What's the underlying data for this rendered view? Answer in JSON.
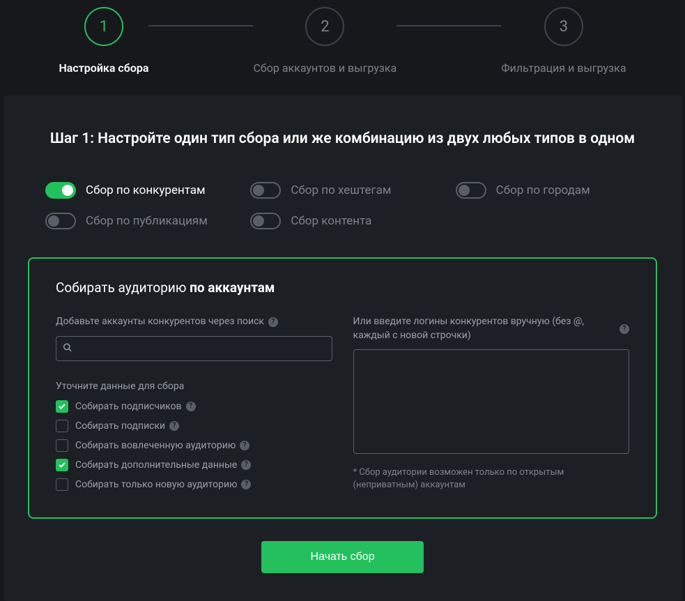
{
  "stepper": {
    "steps": [
      {
        "number": "1",
        "label": "Настройка сбора",
        "active": true
      },
      {
        "number": "2",
        "label": "Сбор аккаунтов и выгрузка",
        "active": false
      },
      {
        "number": "3",
        "label": "Фильтрация и выгрузка",
        "active": false
      }
    ]
  },
  "main": {
    "title": "Шаг 1: Настройте один тип сбора или же комбинацию из двух любых типов в одном"
  },
  "toggles": [
    {
      "label": "Сбор по конкурентам",
      "on": true
    },
    {
      "label": "Сбор по хештегам",
      "on": false
    },
    {
      "label": "Сбор по городам",
      "on": false
    },
    {
      "label": "Сбор по публикациям",
      "on": false
    },
    {
      "label": "Сбор контента",
      "on": false
    }
  ],
  "form": {
    "title_prefix": "Собирать аудиторию ",
    "title_bold": "по аккаунтам",
    "search_label": "Добавьте аккаунты конкурентов через поиск",
    "section_label": "Уточните данные для сбора",
    "checkboxes": [
      {
        "label": "Собирать подписчиков",
        "checked": true
      },
      {
        "label": "Собирать подписки",
        "checked": false
      },
      {
        "label": "Собирать вовлеченную аудиторию",
        "checked": false
      },
      {
        "label": "Собирать дополнительные данные",
        "checked": true
      },
      {
        "label": "Собирать только новую аудиторию",
        "checked": false
      }
    ],
    "textarea_label": "Или введите логины конкурентов вручную (без @, каждый с новой строчки)",
    "hint": "* Сбор аудитории возможен только по открытым (неприватным) аккаунтам"
  },
  "submit": {
    "label": "Начать сбор"
  }
}
